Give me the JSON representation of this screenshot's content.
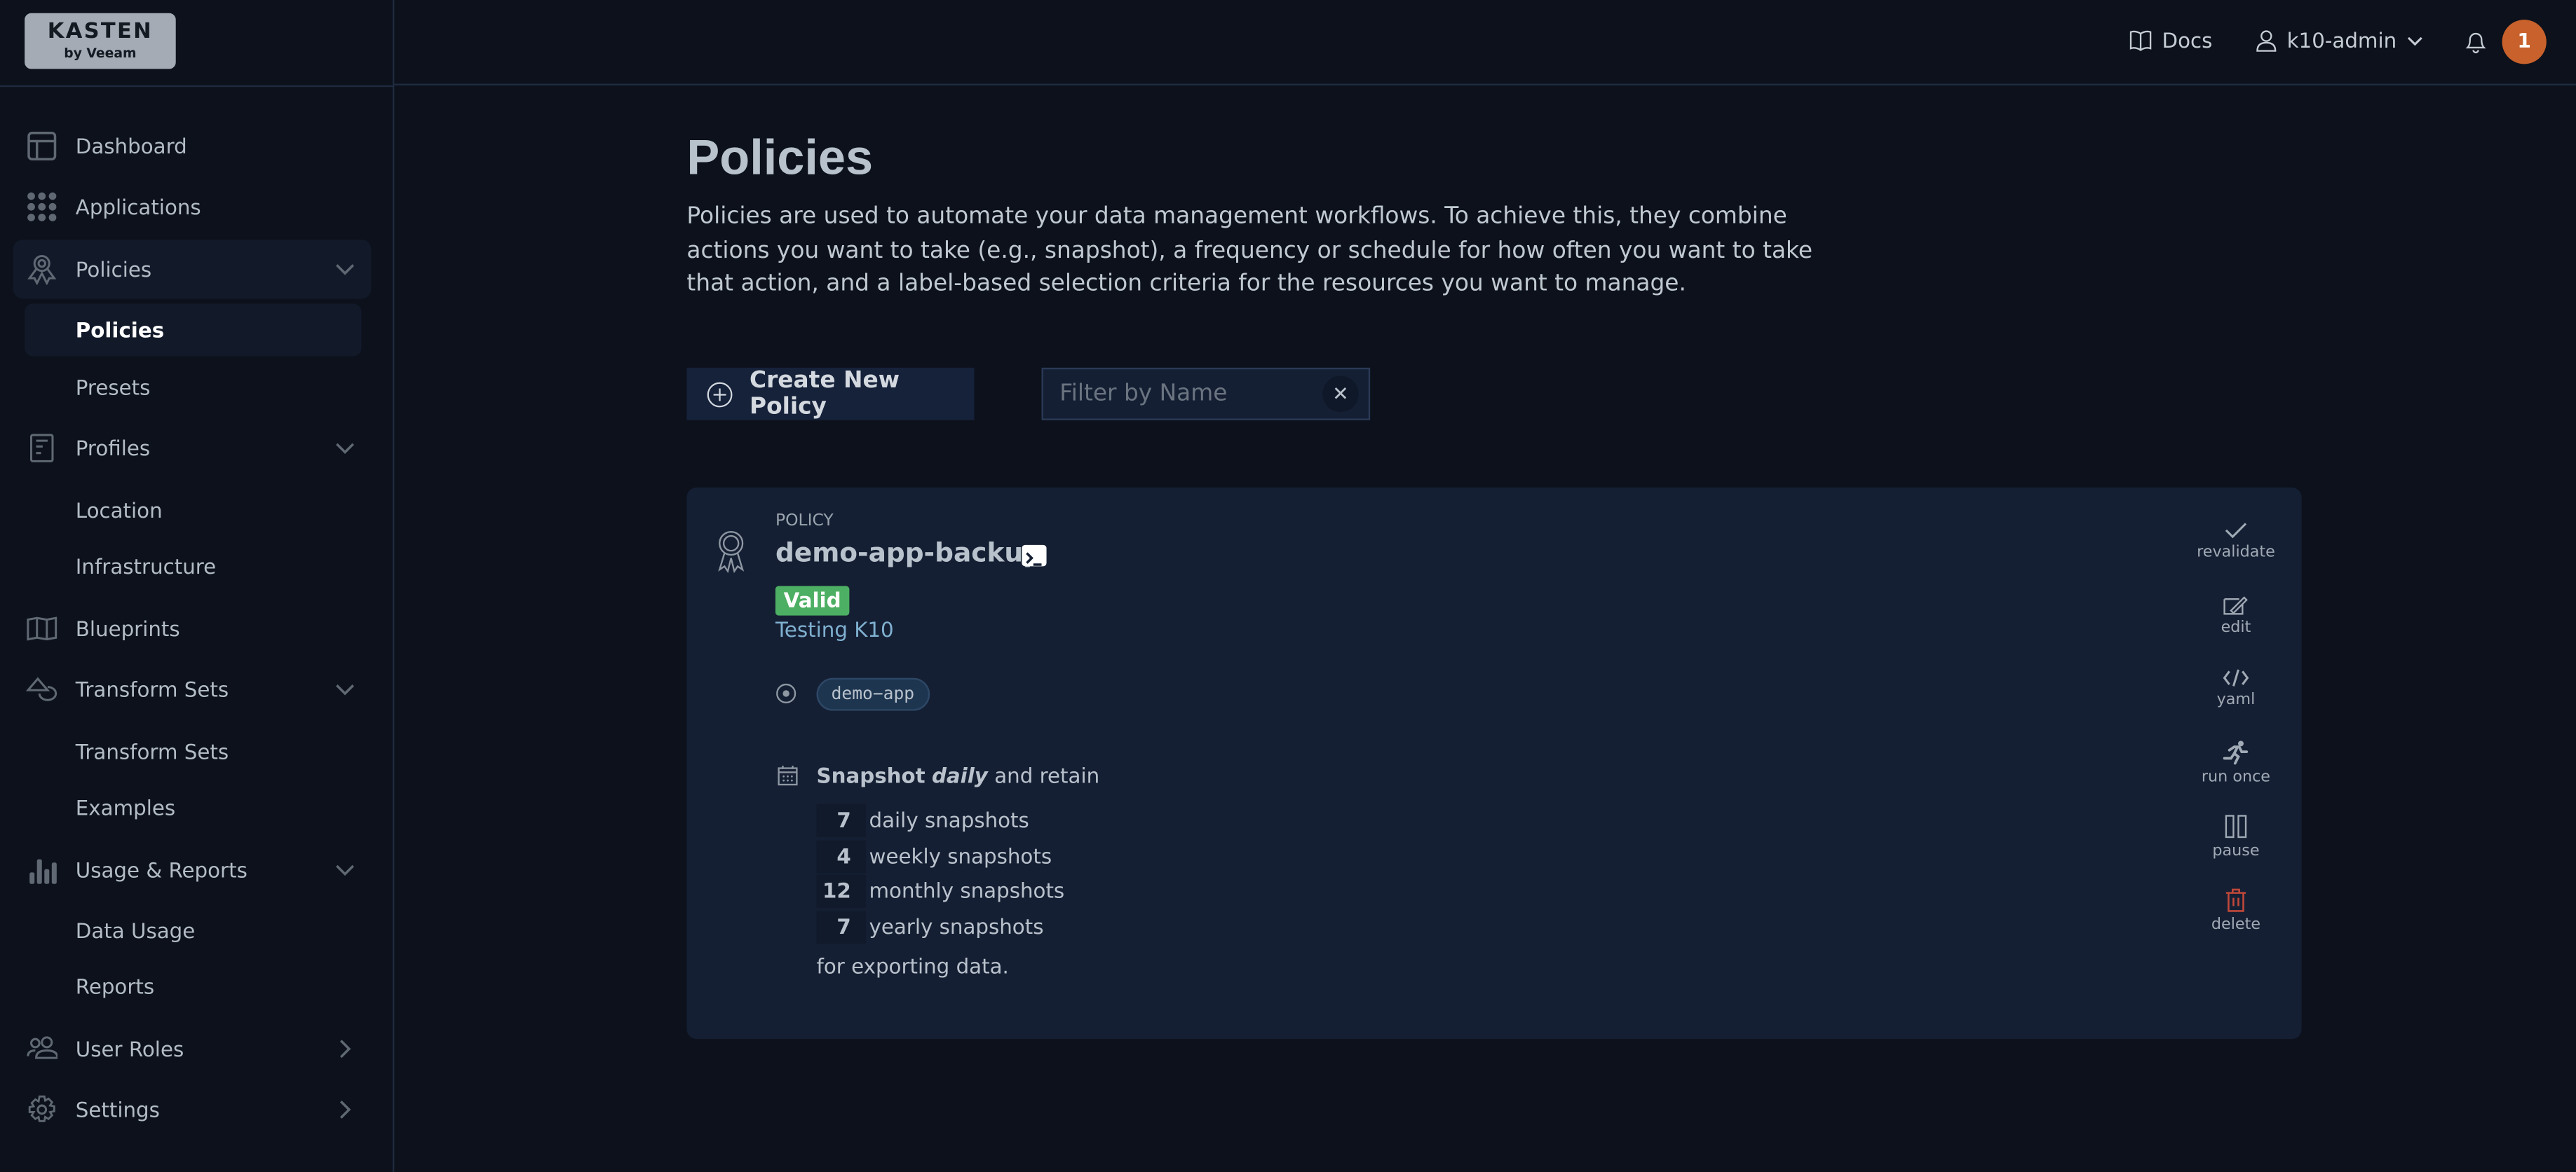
{
  "logo": {
    "brand": "KASTEN",
    "sub": "by Veeam"
  },
  "header": {
    "docs": "Docs",
    "user": "k10-admin",
    "notification_count": "1",
    "badge_color": "#c8612b"
  },
  "sidebar": {
    "items": [
      {
        "label": "Dashboard",
        "icon": "dashboard-icon"
      },
      {
        "label": "Applications",
        "icon": "grid-icon"
      },
      {
        "label": "Policies",
        "icon": "award-icon",
        "expanded": true,
        "children": [
          {
            "label": "Policies",
            "active": true
          },
          {
            "label": "Presets"
          }
        ]
      },
      {
        "label": "Profiles",
        "icon": "profile-icon",
        "expanded": true,
        "children": [
          {
            "label": "Location"
          },
          {
            "label": "Infrastructure"
          }
        ]
      },
      {
        "label": "Blueprints",
        "icon": "map-icon"
      },
      {
        "label": "Transform Sets",
        "icon": "shapes-icon",
        "expanded": true,
        "children": [
          {
            "label": "Transform Sets"
          },
          {
            "label": "Examples"
          }
        ]
      },
      {
        "label": "Usage & Reports",
        "icon": "bar-chart-icon",
        "expanded": true,
        "children": [
          {
            "label": "Data Usage"
          },
          {
            "label": "Reports"
          }
        ]
      },
      {
        "label": "User Roles",
        "icon": "users-icon"
      },
      {
        "label": "Settings",
        "icon": "gear-icon"
      }
    ]
  },
  "main": {
    "title": "Policies",
    "description": "Policies are used to automate your data management workflows. To achieve this, they combine actions you want to take (e.g., snapshot), a frequency or schedule for how often you want to take that action, and a label-based selection criteria for the resources you want to manage.",
    "create_button": "Create New Policy",
    "filter_placeholder": "Filter by Name",
    "filter_value": ""
  },
  "policy": {
    "type_label": "POLICY",
    "name": "demo-app-backup",
    "status": "Valid",
    "status_color": "#4caf63",
    "comment": "Testing K10",
    "app": "demo−app",
    "schedule_action": "Snapshot",
    "schedule_frequency": "daily",
    "schedule_suffix": "and retain",
    "retention": [
      {
        "count": "7",
        "label": "daily snapshots"
      },
      {
        "count": "4",
        "label": "weekly snapshots"
      },
      {
        "count": "12",
        "label": "monthly snapshots"
      },
      {
        "count": "7",
        "label": "yearly snapshots"
      }
    ],
    "footer": "for exporting data.",
    "actions": [
      "revalidate",
      "edit",
      "yaml",
      "run once",
      "pause",
      "delete"
    ],
    "delete_color": "#c0483a"
  }
}
